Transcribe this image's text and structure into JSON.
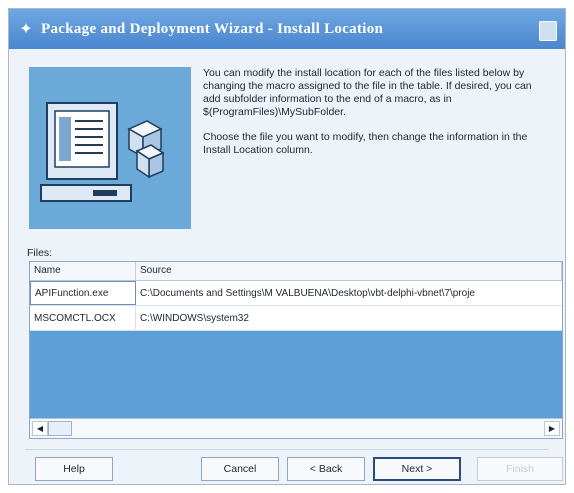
{
  "window": {
    "title": "Package and Deployment Wizard - Install Location"
  },
  "intro": {
    "paragraph1": "You can modify the install location for each of the files listed below by changing the macro assigned to the file in the table. If desired, you can add subfolder information to the end of a macro, as in $(ProgramFiles)\\MySubFolder.",
    "paragraph2": "Choose the file you want to modify, then change the information in the Install Location column."
  },
  "files": {
    "label": "Files:",
    "columns": [
      "Name",
      "Source"
    ],
    "rows": [
      {
        "name": "APIFunction.exe",
        "source": "C:\\Documents and Settings\\M VALBUENA\\Desktop\\vbt-delphi-vbnet\\7\\proje"
      },
      {
        "name": "MSCOMCTL.OCX",
        "source": "C:\\WINDOWS\\system32"
      }
    ]
  },
  "buttons": {
    "help": "Help",
    "cancel": "Cancel",
    "back": "< Back",
    "next": "Next >",
    "finish": "Finish"
  },
  "icons": {
    "title": "wizard-icon",
    "hero": "package-computer-illustration"
  },
  "colors": {
    "title_bar": "#4a86cf",
    "illustration_bg": "#6aa9d8",
    "table_empty_bg": "#5e9ed8"
  }
}
